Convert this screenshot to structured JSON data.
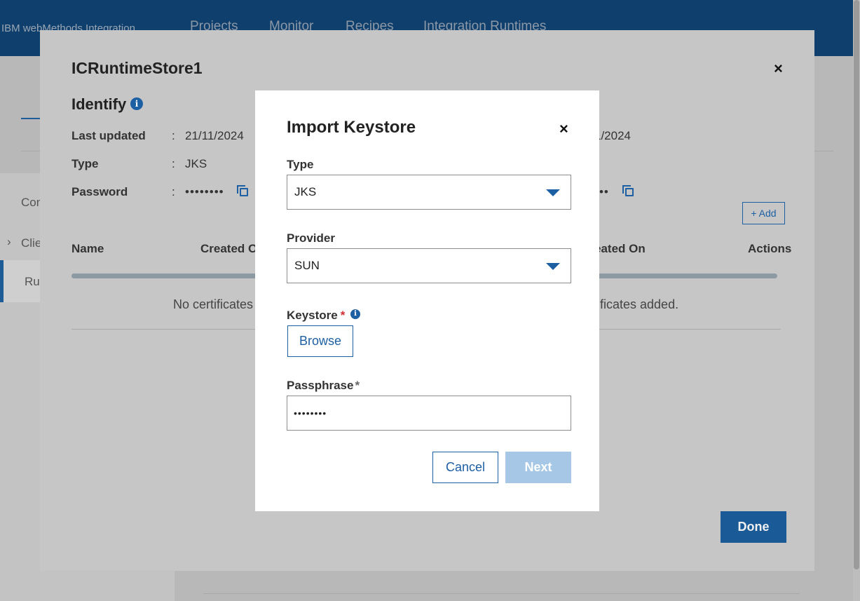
{
  "app": {
    "brand": "IBM webMethods Integration",
    "nav": [
      "Projects",
      "Monitor",
      "Recipes",
      "Integration Runtimes"
    ]
  },
  "sidebar": {
    "items": [
      "Con",
      "Clie",
      "Ru"
    ]
  },
  "outer_modal": {
    "title": "ICRuntimeStore1",
    "section_title": "Identify",
    "fields": {
      "last_updated_label": "Last updated",
      "last_updated_value": "21/11/2024",
      "last_updated_value_right": "1/2024",
      "type_label": "Type",
      "type_value": "JKS",
      "password_label": "Password",
      "password_value": "••••••••",
      "password_value_right": "•••",
      "colon": ":"
    },
    "add_button": "+ Add",
    "table": {
      "headers": [
        "Name",
        "Created O",
        "eated On",
        "Actions"
      ],
      "empty_left": "No certificates",
      "empty_right": "ificates added."
    },
    "done_button": "Done"
  },
  "dialog": {
    "title": "Import Keystore",
    "type_label": "Type",
    "type_value": "JKS",
    "provider_label": "Provider",
    "provider_value": "SUN",
    "keystore_label": "Keystore",
    "required_mark": "*",
    "browse_button": "Browse",
    "passphrase_label": "Passphrase",
    "passphrase_value": "••••••••",
    "cancel_button": "Cancel",
    "next_button": "Next"
  },
  "icons": {
    "close": "×",
    "info": "i"
  },
  "colors": {
    "accent": "#1d5fa3",
    "topbar": "#0f3f6d",
    "next_disabled": "#a6c8e6",
    "required": "#d32f2f"
  }
}
